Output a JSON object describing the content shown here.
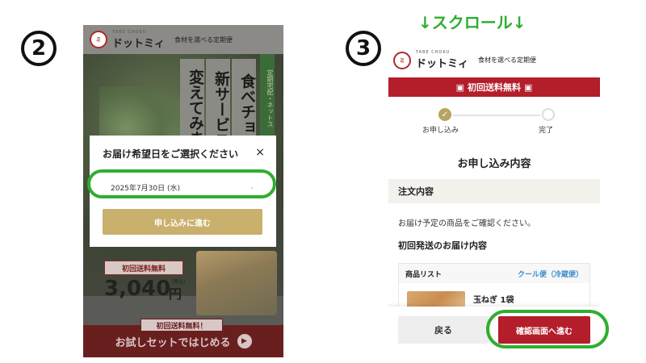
{
  "steps": {
    "step2": "2",
    "step3": "3"
  },
  "scroll_note": "↓スクロール↓",
  "brand": {
    "small": "TABE CHOKU",
    "name": "ドットミィ",
    "tagline": "食材を選べる定期便",
    "mark": "ミ"
  },
  "left_screen": {
    "hero_columns": [
      "食べチョク",
      "新サービス",
      "変えてみま"
    ],
    "side_ribbon": "定期宅配・ネットス",
    "price_label": "初回送料無料",
    "price_value": "3,040",
    "price_unit": "円",
    "price_tax": "(税込)",
    "bottom_tag": "初回送料無料！",
    "bottom_banner": "お試しセットではじめる",
    "modal": {
      "title": "お届け希望日をご選択ください",
      "close": "×",
      "selected_date": "2025年7月30日 (水)",
      "caret": "⌄",
      "proceed": "申し込みに進む"
    }
  },
  "right_screen": {
    "banner": "初回送料無料",
    "progress": {
      "step1": "お申し込み",
      "step2": "完了",
      "check": "✓"
    },
    "order_title": "お申し込み内容",
    "section_head": "注文内容",
    "confirm_text": "お届け予定の商品をご確認ください。",
    "first_ship": "初回発送のお届け内容",
    "product_list_label": "商品リスト",
    "shipping_type": "クール便（冷蔵便）",
    "product_name": "玉ねぎ 1袋",
    "back_button": "戻る",
    "confirm_button": "確認画面へ進む"
  },
  "colors": {
    "accent_red": "#b41d2a",
    "gold": "#c9b06c",
    "highlight_green": "#2fae2f",
    "link_blue": "#3b8ecb"
  }
}
